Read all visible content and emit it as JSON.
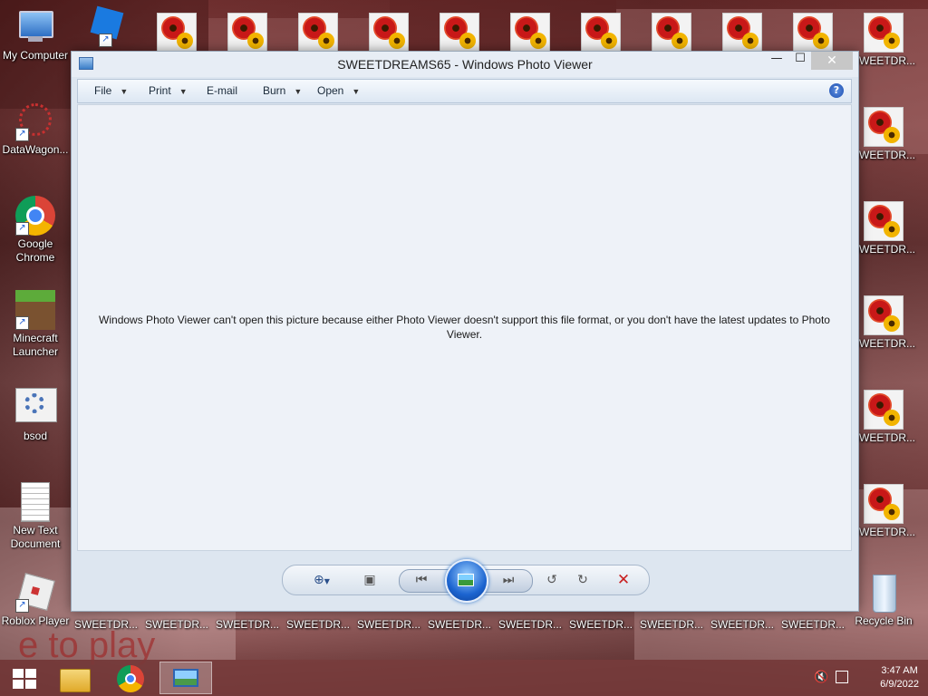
{
  "desktop": {
    "left_icons": [
      {
        "label": "My Computer"
      },
      {
        "label": "DataWagon..."
      },
      {
        "label": "Google Chrome"
      },
      {
        "label": "Minecraft Launcher"
      },
      {
        "label": "bsod"
      },
      {
        "label": "New Text Document"
      },
      {
        "label": "Roblox Player"
      }
    ],
    "flower_label": "SWEETDR...",
    "recycle_bin": "Recycle Bin",
    "wallpaper_text": "e to play"
  },
  "window": {
    "title": "SWEETDREAMS65 - Windows Photo Viewer",
    "minimize": "—",
    "maximize": "☐",
    "close": "✕",
    "menu": {
      "file": "File",
      "print": "Print",
      "email": "E-mail",
      "burn": "Burn",
      "open": "Open",
      "help": "?"
    },
    "message": "Windows Photo Viewer can't open this picture because either Photo Viewer doesn't support this file format, or you don't have the latest updates to Photo Viewer.",
    "controls": {
      "zoom_icon": "zoom-icon",
      "fit_icon": "actual-size-icon",
      "prev_icon": "previous-icon",
      "slideshow_icon": "slideshow-icon",
      "next_icon": "next-icon",
      "rotate_left_icon": "rotate-counterclockwise-icon",
      "rotate_right_icon": "rotate-clockwise-icon",
      "delete_icon": "delete-icon"
    }
  },
  "taskbar": {
    "time": "3:47 AM",
    "date": "6/9/2022"
  },
  "colors": {
    "delete_red": "#c82020",
    "accent_blue": "#1c64d0"
  }
}
